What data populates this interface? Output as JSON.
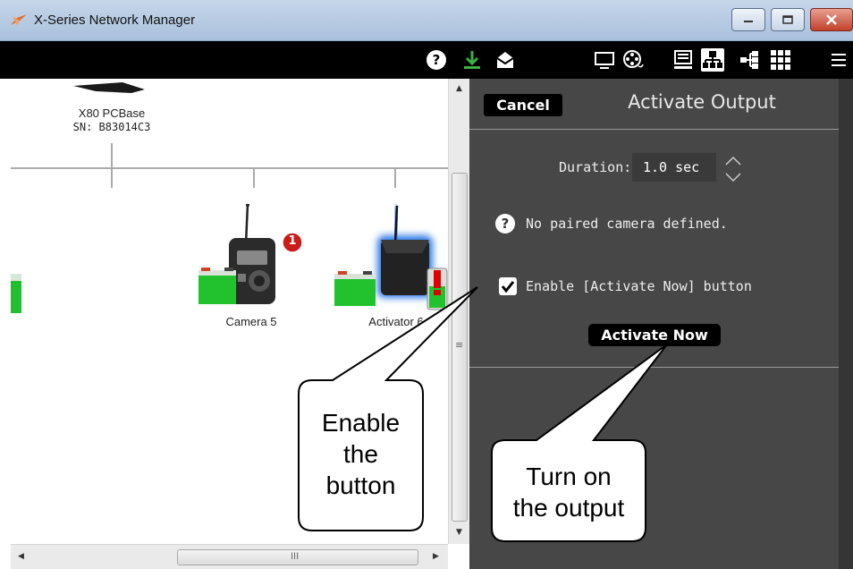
{
  "window": {
    "title": "X-Series Network Manager"
  },
  "toolbar": {
    "icons": [
      "help-icon",
      "download-icon",
      "mail-icon",
      "monitor-icon",
      "film-reel-icon",
      "report-icon",
      "network-icon",
      "tree-icon",
      "grid-icon",
      "hamburger-menu-icon"
    ],
    "colors": {
      "background": "#000000",
      "download": "#3cb043"
    }
  },
  "network": {
    "base": {
      "name": "X80 PCBase",
      "serial": "SN: B83014C3"
    },
    "devices": [
      {
        "name": "Camera 5",
        "badge": "1"
      },
      {
        "name": "Activator 6"
      }
    ]
  },
  "panel": {
    "cancel_label": "Cancel",
    "title": "Activate Output",
    "duration_label": "Duration:",
    "duration_value": "1.0 sec",
    "info_text": "No paired camera defined.",
    "enable_label": "Enable [Activate Now] button",
    "enable_checked": true,
    "activate_label": "Activate Now",
    "colors": {
      "background": "#474747",
      "button": "#000000"
    }
  },
  "scrollbar": {
    "h_thumb_label": "III",
    "v_thumb_label": "≡"
  },
  "callouts": {
    "enable": "Enable\nthe\nbutton",
    "turn_on": "Turn on\nthe output"
  }
}
